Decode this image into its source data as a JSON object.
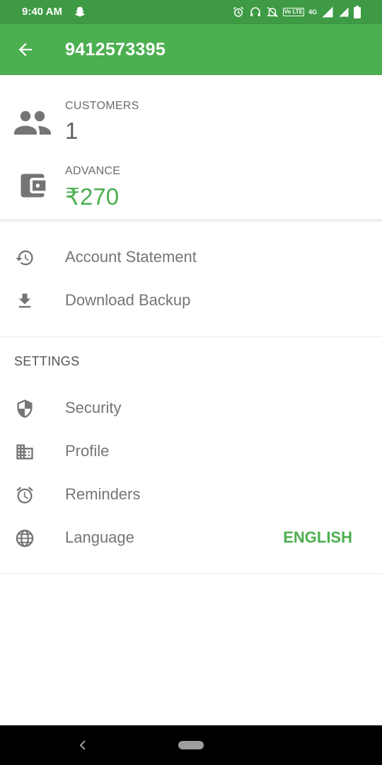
{
  "status_bar": {
    "time": "9:40 AM",
    "lte_label": "Vo LTE",
    "network_label": "4G",
    "icons": [
      "snapchat-icon",
      "alarm-icon",
      "headset-icon",
      "notifications-off-icon",
      "signal-icon",
      "battery-icon"
    ]
  },
  "app_bar": {
    "title": "9412573395",
    "back_icon": "arrow-back-icon",
    "color": "#4caf50"
  },
  "summary": {
    "customers_label": "CUSTOMERS",
    "customers_value": "1",
    "advance_label": "ADVANCE",
    "advance_value": "₹270",
    "advance_color": "#4caf50"
  },
  "menu": {
    "account_statement": "Account Statement",
    "download_backup": "Download Backup"
  },
  "settings": {
    "title": "SETTINGS",
    "security": "Security",
    "profile": "Profile",
    "reminders": "Reminders",
    "language": "Language",
    "language_value": "ENGLISH"
  }
}
